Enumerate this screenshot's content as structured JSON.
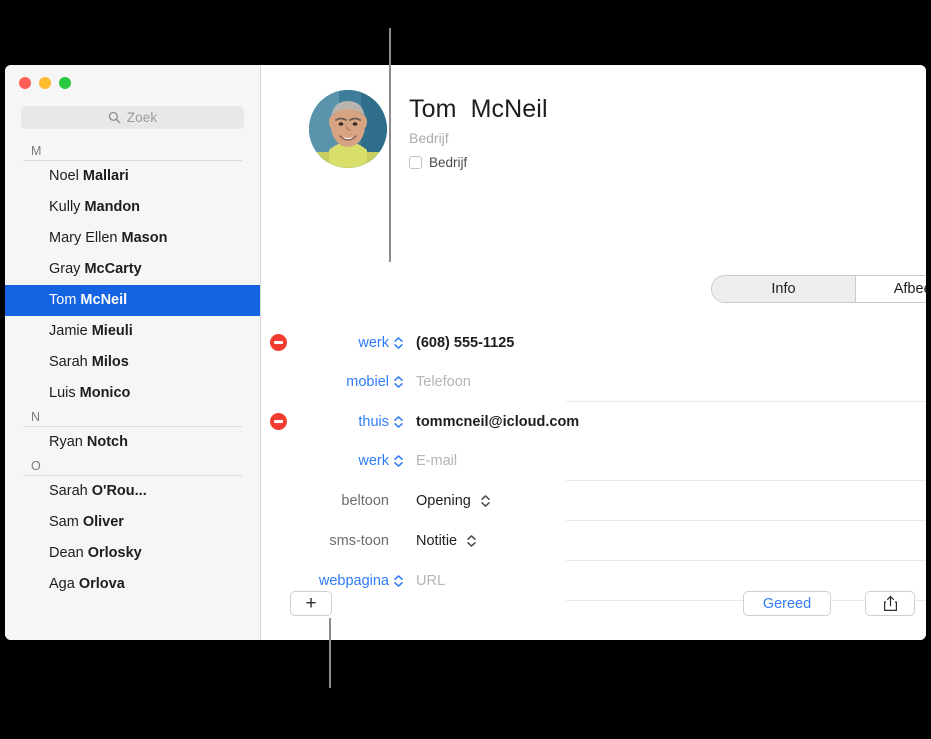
{
  "window": {
    "traffic_lights": [
      {
        "name": "close",
        "color": "#ff5f57"
      },
      {
        "name": "minimize",
        "color": "#febc2e"
      },
      {
        "name": "zoom",
        "color": "#28c840"
      }
    ]
  },
  "sidebar": {
    "search": {
      "placeholder": "Zoek",
      "value": "",
      "icon": "search-icon"
    },
    "sections": [
      {
        "letter": "M",
        "contacts": [
          {
            "first": "Noel ",
            "last": "Mallari",
            "selected": false
          },
          {
            "first": "Kully ",
            "last": "Mandon",
            "selected": false
          },
          {
            "first": "Mary Ellen ",
            "last": "Mason",
            "selected": false
          },
          {
            "first": "Gray ",
            "last": "McCarty",
            "selected": false
          },
          {
            "first": "Tom ",
            "last": "McNeil",
            "selected": true
          },
          {
            "first": "Jamie ",
            "last": "Mieuli",
            "selected": false
          },
          {
            "first": "Sarah ",
            "last": "Milos",
            "selected": false
          },
          {
            "first": "Luis ",
            "last": "Monico",
            "selected": false
          }
        ]
      },
      {
        "letter": "N",
        "contacts": [
          {
            "first": "Ryan ",
            "last": "Notch",
            "selected": false
          }
        ]
      },
      {
        "letter": "O",
        "contacts": [
          {
            "first": "Sarah ",
            "last": "O'Rou...",
            "selected": false
          },
          {
            "first": "Sam ",
            "last": "Oliver",
            "selected": false
          },
          {
            "first": "Dean ",
            "last": "Orlosky",
            "selected": false
          },
          {
            "first": "Aga ",
            "last": "Orlova",
            "selected": false
          }
        ]
      }
    ]
  },
  "detail": {
    "avatar_alt": "contact-photo",
    "name": "Tom  McNeil",
    "company_placeholder": "Bedrijf",
    "company_checkbox_label": "Bedrijf",
    "company_checkbox_checked": false,
    "tabs": [
      {
        "label": "Info",
        "active": true
      },
      {
        "label": "Afbeelding",
        "active": false
      }
    ],
    "fields": [
      {
        "id": "phone-work",
        "deletable": true,
        "label": "werk",
        "label_color": "blue",
        "has_stepper": true,
        "value": "(608) 555-1125",
        "value_style": "bold",
        "value_has_stepper": false,
        "separator_after": false
      },
      {
        "id": "phone-mobile",
        "deletable": false,
        "label": "mobiel",
        "label_color": "blue",
        "has_stepper": true,
        "value": "Telefoon",
        "value_style": "placeholder",
        "value_has_stepper": false,
        "separator_after": true
      },
      {
        "id": "email-home",
        "deletable": true,
        "label": "thuis",
        "label_color": "blue",
        "has_stepper": true,
        "value": "tommcneil@icloud.com",
        "value_style": "bold",
        "value_has_stepper": false,
        "separator_after": false
      },
      {
        "id": "email-work",
        "deletable": false,
        "label": "werk",
        "label_color": "blue",
        "has_stepper": true,
        "value": "E-mail",
        "value_style": "placeholder",
        "value_has_stepper": false,
        "separator_after": true
      },
      {
        "id": "ringtone",
        "deletable": false,
        "label": "beltoon",
        "label_color": "grey",
        "has_stepper": false,
        "value": "Opening",
        "value_style": "normal",
        "value_has_stepper": true,
        "separator_after": true
      },
      {
        "id": "text-tone",
        "deletable": false,
        "label": "sms-toon",
        "label_color": "grey",
        "has_stepper": false,
        "value": "Notitie",
        "value_style": "normal",
        "value_has_stepper": true,
        "separator_after": true
      },
      {
        "id": "webpage",
        "deletable": false,
        "label": "webpagina",
        "label_color": "blue",
        "has_stepper": true,
        "value": "URL",
        "value_style": "placeholder",
        "value_has_stepper": false,
        "separator_after": true
      }
    ],
    "bottom_bar": {
      "add_label": "+",
      "done_label": "Gereed",
      "share_icon": "share-icon"
    }
  },
  "colors": {
    "selection_blue": "#1463e0",
    "link_blue": "#2f7cf6",
    "delete_red": "#f13d30",
    "placeholder_grey": "#b4b4b4"
  }
}
